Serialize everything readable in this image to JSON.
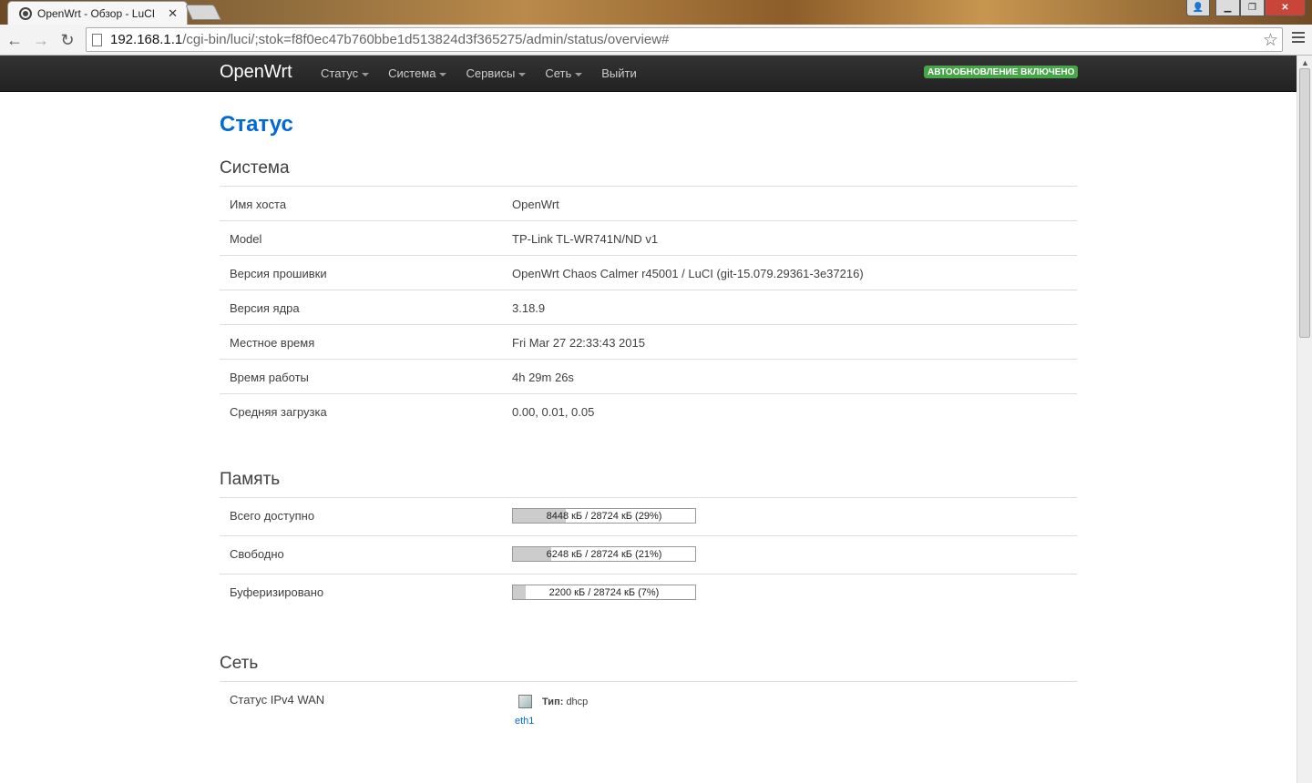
{
  "browser": {
    "tab_title": "OpenWrt - Обзор - LuCI",
    "url_host": "192.168.1.1",
    "url_path": "/cgi-bin/luci/;stok=f8f0ec47b760bbe1d513824d3f365275/admin/status/overview#"
  },
  "navbar": {
    "brand": "OpenWrt",
    "menu": [
      "Статус",
      "Система",
      "Сервисы",
      "Сеть",
      "Выйти"
    ],
    "autorefresh": "АВТООБНОВЛЕНИЕ ВКЛЮЧЕНО"
  },
  "page": {
    "title": "Статус"
  },
  "system": {
    "title": "Система",
    "rows": [
      {
        "label": "Имя хоста",
        "value": "OpenWrt"
      },
      {
        "label": "Model",
        "value": "TP-Link TL-WR741N/ND v1"
      },
      {
        "label": "Версия прошивки",
        "value": "OpenWrt Chaos Calmer r45001 / LuCI (git-15.079.29361-3e37216)"
      },
      {
        "label": "Версия ядра",
        "value": "3.18.9"
      },
      {
        "label": "Местное время",
        "value": "Fri Mar 27 22:33:43 2015"
      },
      {
        "label": "Время работы",
        "value": "4h 29m 26s"
      },
      {
        "label": "Средняя загрузка",
        "value": "0.00, 0.01, 0.05"
      }
    ]
  },
  "memory": {
    "title": "Память",
    "rows": [
      {
        "label": "Всего доступно",
        "text": "8448 кБ / 28724 кБ (29%)",
        "percent": 29
      },
      {
        "label": "Свободно",
        "text": "6248 кБ / 28724 кБ (21%)",
        "percent": 21
      },
      {
        "label": "Буферизировано",
        "text": "2200 кБ / 28724 кБ (7%)",
        "percent": 7
      }
    ]
  },
  "network": {
    "title": "Сеть",
    "wan_label": "Статус IPv4 WAN",
    "type_label": "Тип:",
    "type_value": "dhcp",
    "iface": "eth1"
  }
}
